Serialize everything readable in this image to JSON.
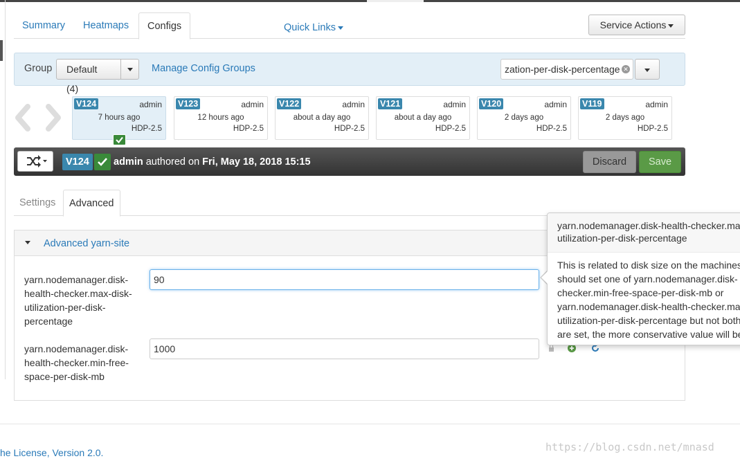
{
  "tabs": {
    "summary": "Summary",
    "heatmaps": "Heatmaps",
    "configs": "Configs"
  },
  "quick_links_label": "Quick Links",
  "service_actions_label": "Service Actions",
  "group_bar": {
    "label": "Group",
    "selected_group": "Default (4)",
    "manage_link": "Manage Config Groups",
    "filter_value": "zation-per-disk-percentage"
  },
  "versions": [
    {
      "id": "V124",
      "author": "admin",
      "time": "7 hours ago",
      "stack": "HDP-2.5"
    },
    {
      "id": "V123",
      "author": "admin",
      "time": "12 hours ago",
      "stack": "HDP-2.5"
    },
    {
      "id": "V122",
      "author": "admin",
      "time": "about a day ago",
      "stack": "HDP-2.5"
    },
    {
      "id": "V121",
      "author": "admin",
      "time": "about a day ago",
      "stack": "HDP-2.5"
    },
    {
      "id": "V120",
      "author": "admin",
      "time": "2 days ago",
      "stack": "HDP-2.5"
    },
    {
      "id": "V119",
      "author": "admin",
      "time": "2 days ago",
      "stack": "HDP-2.5"
    }
  ],
  "version_bar": {
    "badge": "V124",
    "author": "admin",
    "authored_text": "authored on",
    "date": "Fri, May 18, 2018 15:15",
    "discard_label": "Discard",
    "save_label": "Save"
  },
  "sub_tabs": {
    "settings": "Settings",
    "advanced": "Advanced"
  },
  "panel_title": "Advanced yarn-site",
  "properties": [
    {
      "label": "yarn.nodemanager.disk-health-checker.max-disk-utilization-per-disk-percentage",
      "lines": [
        "yarn.nodemanager.disk-",
        "health-checker.max-disk-",
        "utilization-per-disk-",
        "percentage"
      ],
      "value": "90"
    },
    {
      "label": "yarn.nodemanager.disk-health-checker.min-free-space-per-disk-mb",
      "lines": [
        "yarn.nodemanager.disk-",
        "health-checker.min-free-",
        "space-per-disk-mb"
      ],
      "value": "1000"
    }
  ],
  "popover": {
    "title_lines": [
      "yarn.nodemanager.disk-health-checker.max-",
      "utilization-per-disk-percentage"
    ],
    "body_lines": [
      "This is related to disk size on the machines",
      "should set one of yarn.nodemanager.disk-",
      "checker.min-free-space-per-disk-mb or",
      "yarn.nodemanager.disk-health-checker.max-",
      "utilization-per-disk-percentage but not both",
      "are set, the more conservative value will be"
    ]
  },
  "footer_link": "he License, Version 2.0.",
  "watermark": "https://blog.csdn.net/mnasd",
  "colors": {
    "link": "#2a7ab8",
    "version_badge": "#3a87ad",
    "save_green": "#5a9a46",
    "check_green": "#3a8a3a",
    "group_bar_bg": "#e3eff7"
  }
}
